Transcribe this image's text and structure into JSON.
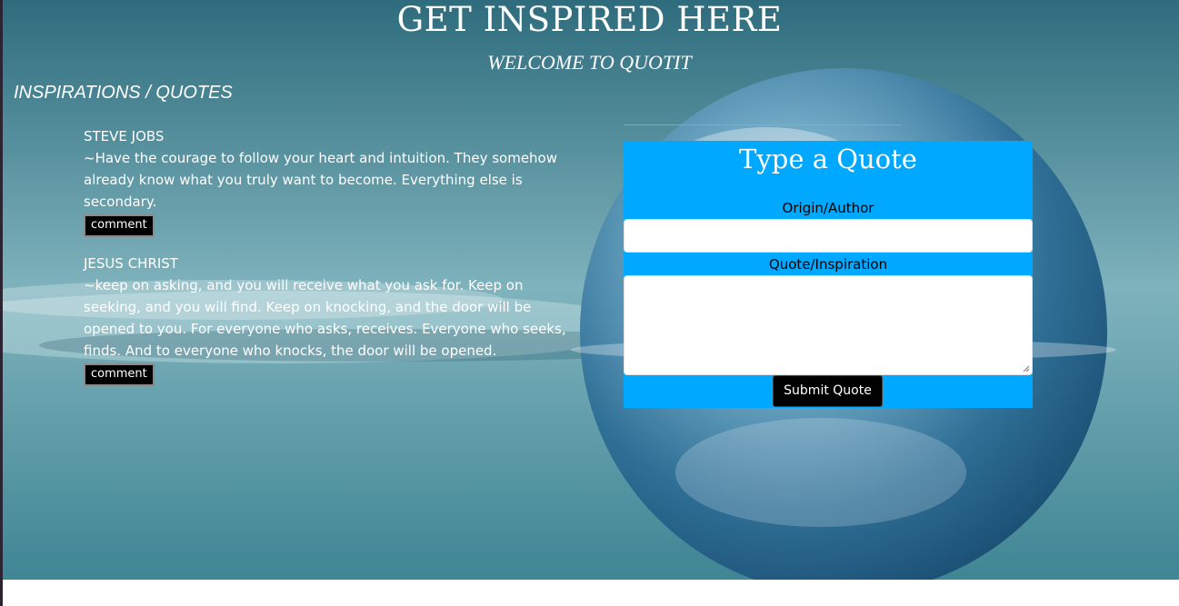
{
  "header": {
    "title": "GET INSPIRED HERE",
    "subtitle": "WELCOME TO QUOTIT"
  },
  "quotes_section": {
    "heading": "INSPIRATIONS / QUOTES",
    "items": [
      {
        "author": "STEVE JOBS",
        "text": "~Have the courage to follow your heart and intuition. They somehow already know what you truly want to become. Everything else is secondary.",
        "comment_label": "comment"
      },
      {
        "author": "JESUS CHRIST",
        "text": "~keep on asking, and you will receive what you ask for. Keep on seeking, and you will find. Keep on knocking, and the door will be opened to you. For everyone who asks, receives. Everyone who seeks, finds. And to everyone who knocks, the door will be opened.",
        "comment_label": "comment"
      }
    ]
  },
  "quote_form": {
    "title": "Type a Quote",
    "author_label": "Origin/Author",
    "author_value": "",
    "quote_label": "Quote/Inspiration",
    "quote_value": "",
    "submit_label": "Submit Quote"
  },
  "colors": {
    "form_background": "#00a8ff",
    "button_background": "#000000",
    "text_light": "#ffffff"
  },
  "icons": {
    "background_image": "earth-water-sphere-image"
  }
}
